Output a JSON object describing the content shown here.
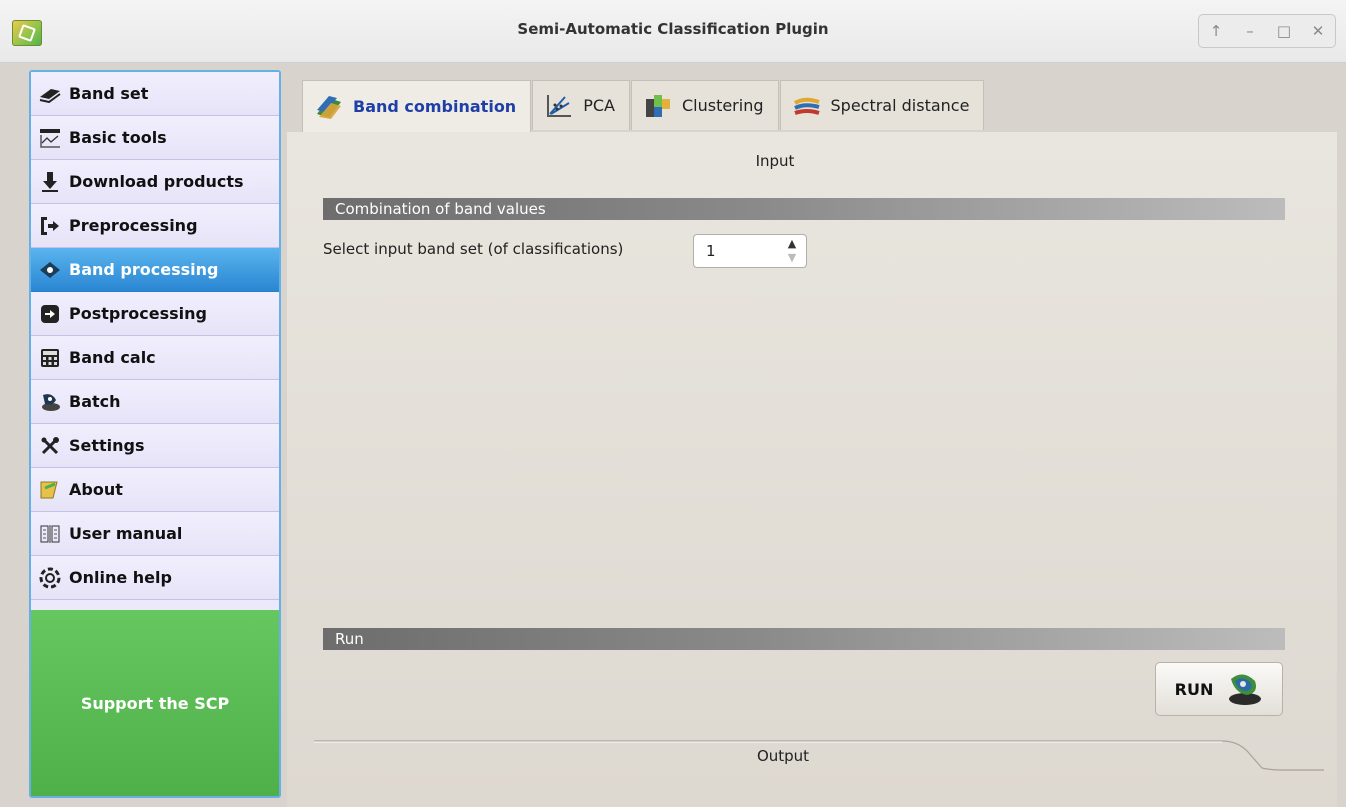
{
  "window": {
    "title": "Semi-Automatic Classification Plugin",
    "controls": [
      "↑",
      "–",
      "□",
      "✕"
    ]
  },
  "sidebar": {
    "items": [
      {
        "label": "Band set",
        "icon": "band-set-icon"
      },
      {
        "label": "Basic tools",
        "icon": "basic-tools-icon"
      },
      {
        "label": "Download products",
        "icon": "download-icon"
      },
      {
        "label": "Preprocessing",
        "icon": "preprocessing-icon"
      },
      {
        "label": "Band processing",
        "icon": "band-processing-icon",
        "active": true
      },
      {
        "label": "Postprocessing",
        "icon": "postprocessing-icon"
      },
      {
        "label": "Band calc",
        "icon": "calculator-icon"
      },
      {
        "label": "Batch",
        "icon": "batch-icon"
      },
      {
        "label": "Settings",
        "icon": "settings-icon"
      },
      {
        "label": "About",
        "icon": "about-icon"
      },
      {
        "label": "User manual",
        "icon": "manual-icon"
      },
      {
        "label": "Online help",
        "icon": "help-icon"
      }
    ],
    "support_label": "Support the SCP"
  },
  "tabs": [
    {
      "label": "Band combination",
      "icon": "band-combination-icon",
      "active": true
    },
    {
      "label": "PCA",
      "icon": "pca-icon"
    },
    {
      "label": "Clustering",
      "icon": "clustering-icon"
    },
    {
      "label": "Spectral distance",
      "icon": "spectral-distance-icon"
    }
  ],
  "main": {
    "input_heading": "Input",
    "combination_section": "Combination of band values",
    "bandset_label": "Select input band set (of classifications)",
    "bandset_value": "1",
    "run_section": "Run",
    "run_label": "RUN",
    "output_heading": "Output"
  },
  "colors": {
    "sidebar_active": "#2a86d2",
    "support": "#4fb04a",
    "active_tab_text": "#1f3fa8"
  }
}
